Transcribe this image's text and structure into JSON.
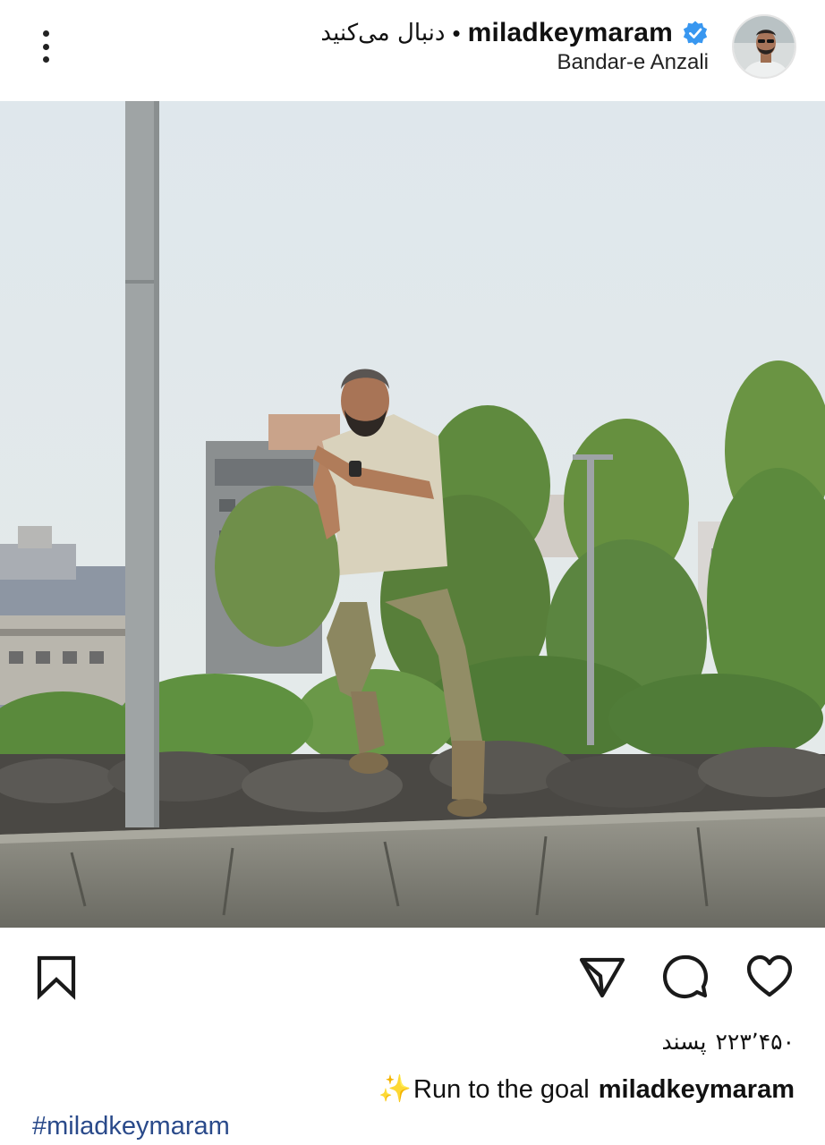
{
  "header": {
    "username": "miladkeymaram",
    "follow_label": "دنبال می‌کنید",
    "separator": "•",
    "location": "Bandar-e Anzali",
    "verified": true,
    "menu_icon": "more-vertical-icon"
  },
  "post": {
    "likes_count": "۲۲۳٬۴۵۰",
    "likes_label": "پسند",
    "caption_emoji": "✨",
    "caption_text": "Run to the goal",
    "caption_username": "miladkeymaram",
    "hashtag": "#miladkeymaram"
  },
  "actions": {
    "bookmark_icon": "bookmark-icon",
    "share_icon": "send-icon",
    "comment_icon": "comment-icon",
    "like_icon": "heart-icon"
  },
  "colors": {
    "verified_badge": "#3897f0",
    "hashtag": "#2a4a8a",
    "sky": "#dde4e8",
    "foliage": "#6f8f4a",
    "wall": "#7d7c72"
  }
}
